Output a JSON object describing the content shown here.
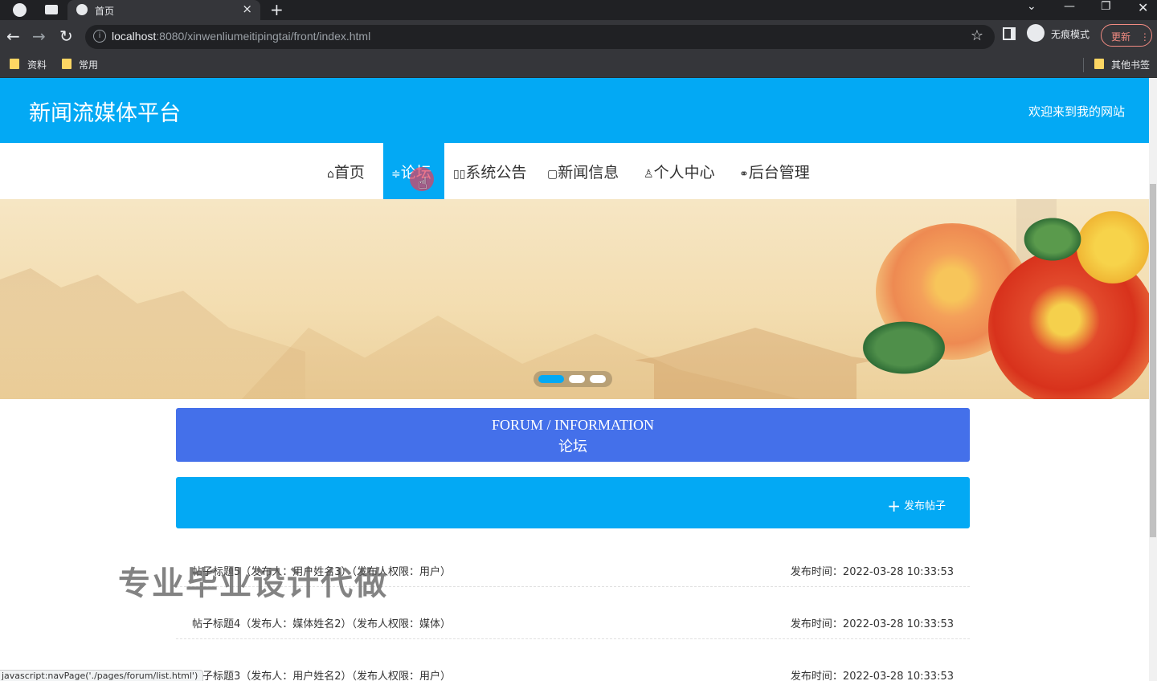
{
  "browser": {
    "tab_title": "首页",
    "url_host": "localhost",
    "url_rest": ":8080/xinwenliumeitipingtai/front/index.html",
    "incognito_label": "无痕模式",
    "update_label": "更新",
    "bookmarks": [
      "资料",
      "常用"
    ],
    "other_bookmarks": "其他书签",
    "status_url": "javascript:navPage('./pages/forum/list.html')"
  },
  "site": {
    "brand": "新闻流媒体平台",
    "welcome": "欢迎来到我的网站",
    "menu": [
      {
        "label": "首页",
        "icon": "⌂",
        "active": false
      },
      {
        "label": "论坛",
        "icon": "≑",
        "active": true
      },
      {
        "label": "系统公告",
        "icon": "▯▯",
        "active": false
      },
      {
        "label": "新闻信息",
        "icon": "▢",
        "active": false
      },
      {
        "label": "个人中心",
        "icon": "♙",
        "active": false
      },
      {
        "label": "后台管理",
        "icon": "⚭",
        "active": false
      }
    ],
    "carousel": {
      "slides": 3,
      "active_index": 0
    }
  },
  "forum": {
    "title_en": "FORUM / INFORMATION",
    "title_cn": "论坛",
    "post_button": "发布帖子",
    "posts": [
      {
        "title": "帖子标题5（发布人：用户姓名3）（发布人权限：用户）",
        "date": "发布时间：2022-03-28 10:33:53"
      },
      {
        "title": "帖子标题4（发布人：媒体姓名2）（发布人权限：媒体）",
        "date": "发布时间：2022-03-28 10:33:53"
      },
      {
        "title": "帖子标题3（发布人：用户姓名2）（发布人权限：用户）",
        "date": "发布时间：2022-03-28 10:33:53"
      }
    ]
  },
  "watermark": "专业毕业设计代做"
}
